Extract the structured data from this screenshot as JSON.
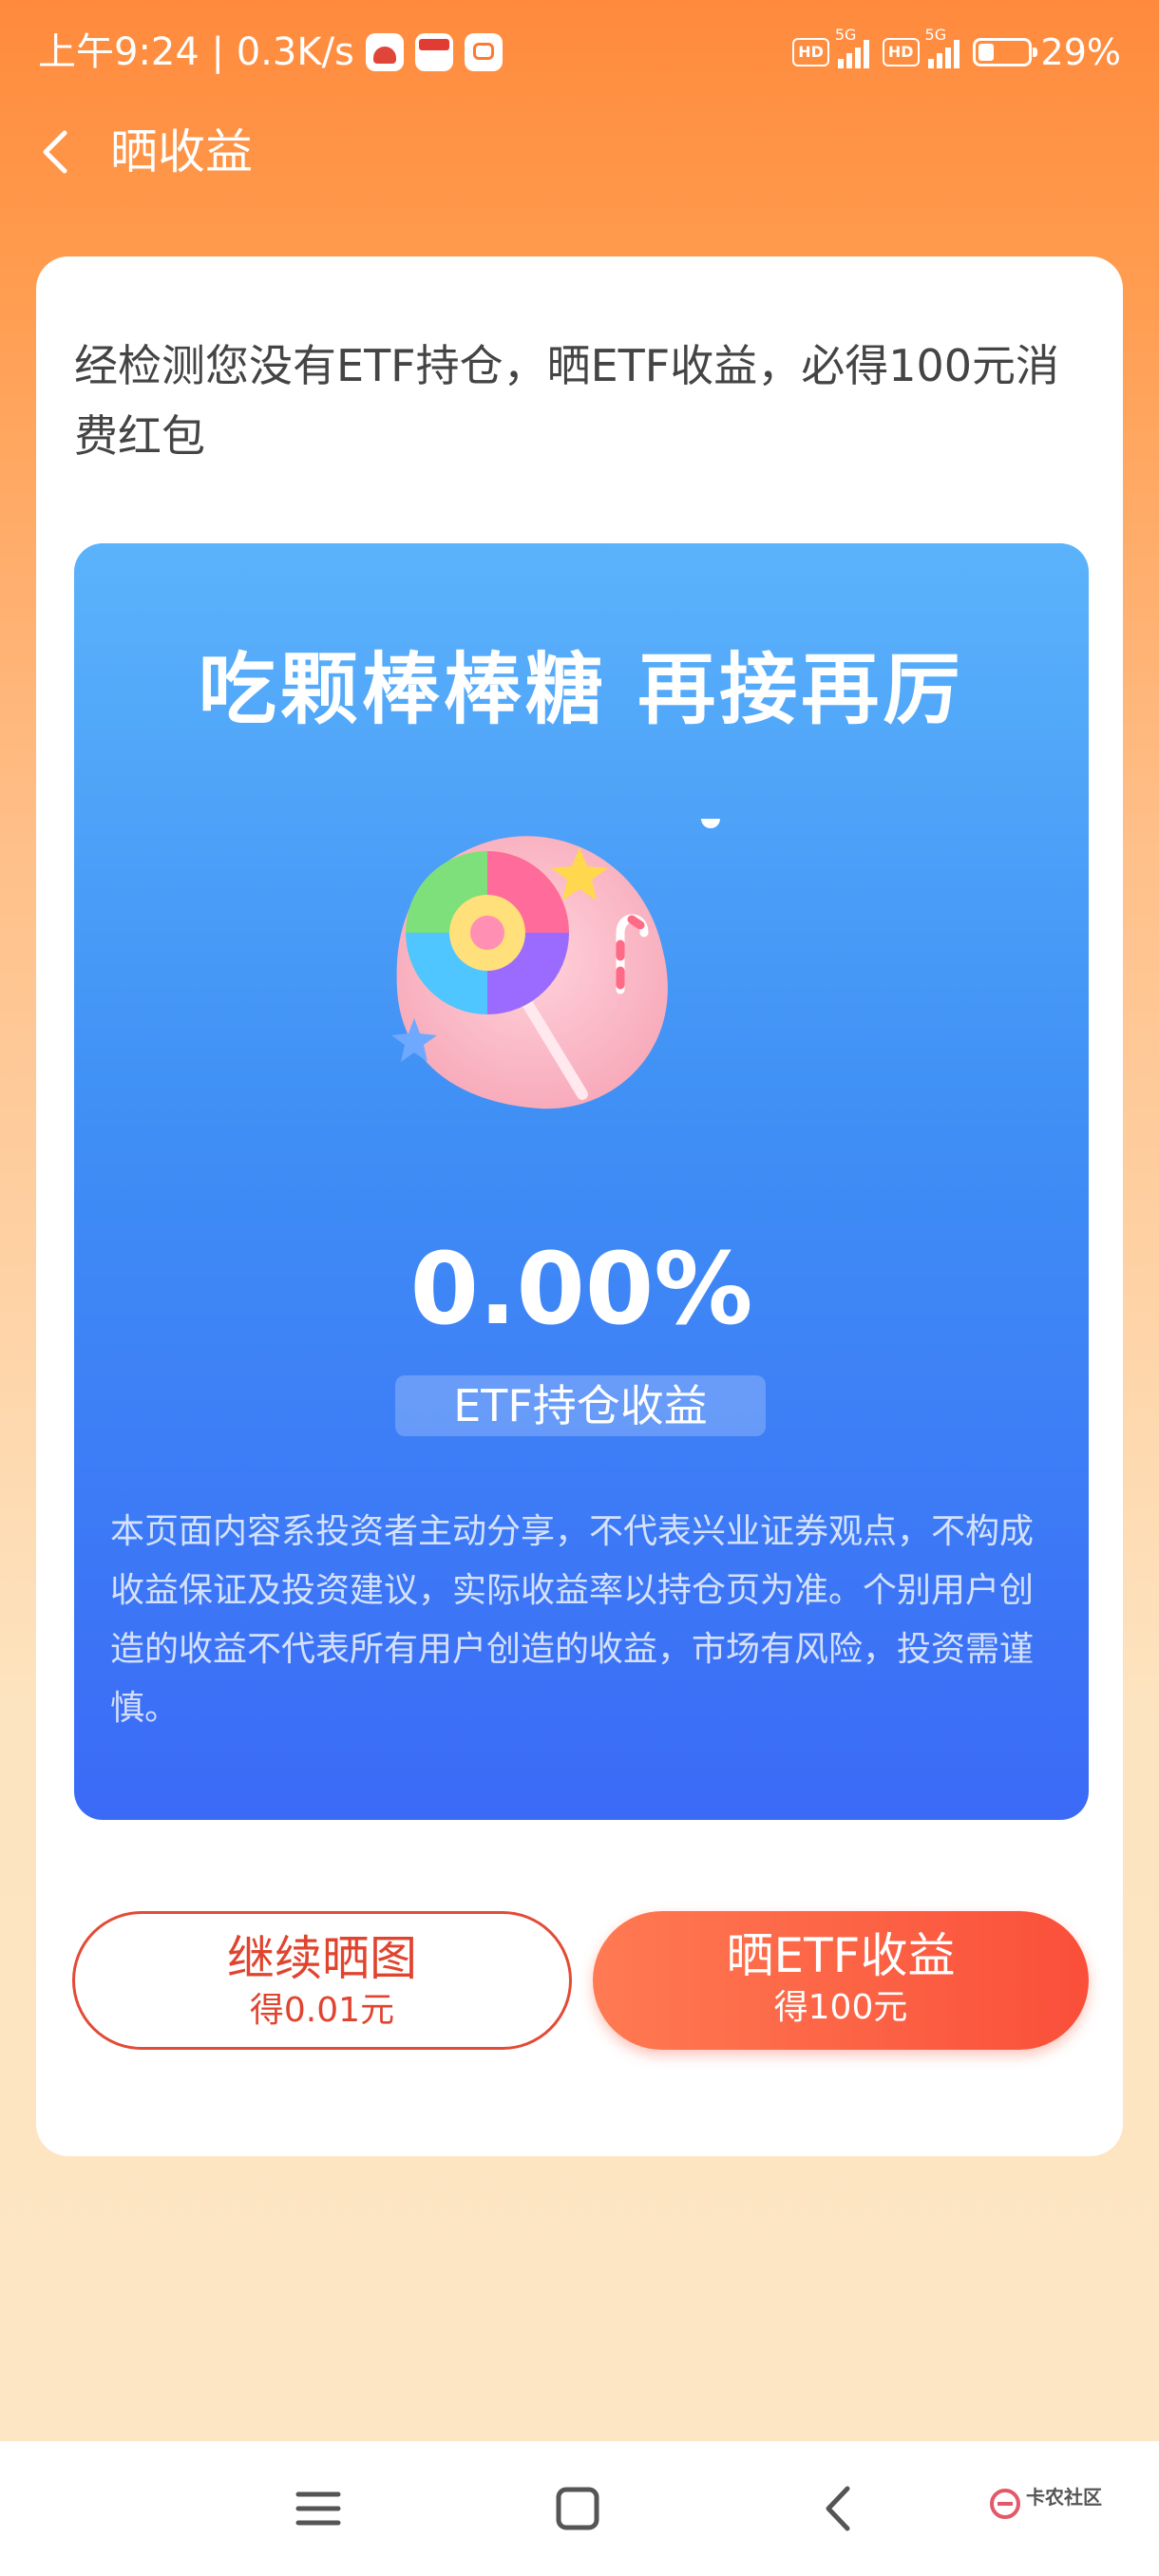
{
  "status_bar": {
    "time_speed": "上午9:24 | 0.3K/s",
    "hd_badge": "HD",
    "network_type": "5G",
    "battery": "29%"
  },
  "header": {
    "title": "晒收益"
  },
  "card": {
    "intro_text": "经检测您没有ETF持仓，晒ETF收益，必得100元消费红包"
  },
  "share_panel": {
    "headline": "吃颗棒棒糖 再接再厉",
    "yield_value": "0.00%",
    "yield_label": "ETF持仓收益",
    "disclaimer": "本页面内容系投资者主动分享，不代表兴业证券观点，不构成收益保证及投资建议，实际收益率以持仓页为准。个别用户创造的收益不代表所有用户创造的收益，市场有风险，投资需谨慎。"
  },
  "buttons": {
    "continue": {
      "label": "继续晒图",
      "reward": "得0.01元"
    },
    "share_etf": {
      "label": "晒ETF收益",
      "reward": "得100元"
    }
  },
  "watermark": {
    "text": "卡农社区"
  },
  "colors": {
    "header_orange": "#ff8a3d",
    "panel_blue": "#3f8ff5",
    "button_red": "#fa4f3a"
  }
}
